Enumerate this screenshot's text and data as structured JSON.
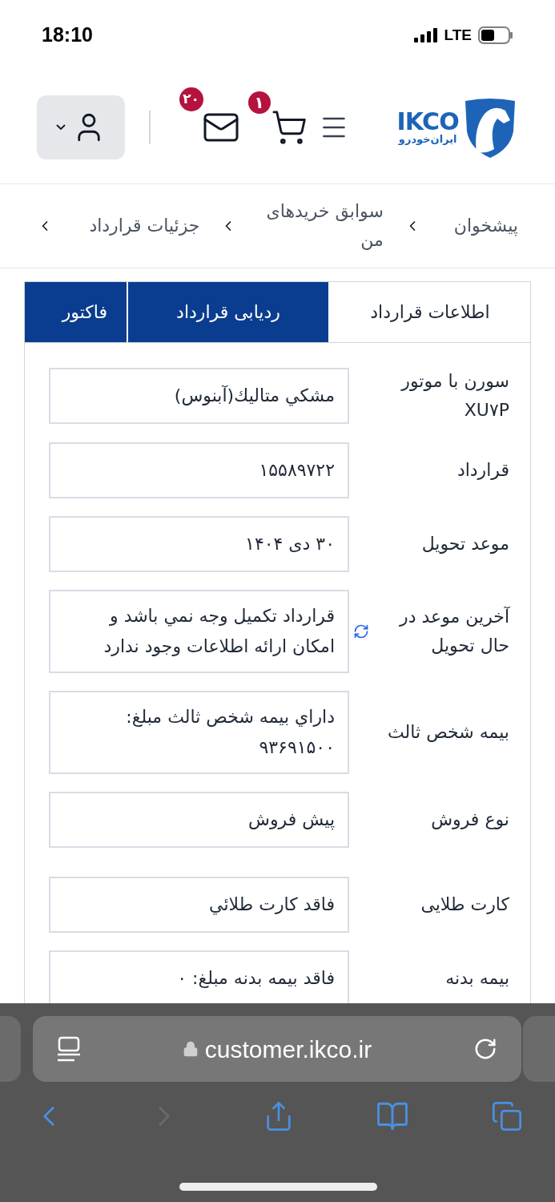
{
  "status_bar": {
    "time": "18:10",
    "network": "LTE"
  },
  "header": {
    "logo_latin": "IKCO",
    "logo_persian": "ایران‌خودرو",
    "cart_count": "۱",
    "mail_count": "۲۰"
  },
  "breadcrumb": [
    {
      "label": "پیشخوان"
    },
    {
      "label": "سوابق خریدهای من"
    },
    {
      "label": "جزئیات قرارداد"
    }
  ],
  "tabs": [
    {
      "label": "اطلاعات قرارداد",
      "selected": true
    },
    {
      "label": "ردیابی قرارداد",
      "selected": false
    },
    {
      "label": "فاکتور",
      "selected": false
    }
  ],
  "fields": [
    {
      "kind": "plain",
      "label": "سورن با موتور XU۷P",
      "value": "مشكي متاليك(آبنوس)"
    },
    {
      "kind": "plain",
      "label": "قرارداد",
      "value": "۱۵۵۸۹۷۲۲"
    },
    {
      "kind": "plain",
      "label": "موعد تحویل",
      "value": "۳۰ دی ۱۴۰۴"
    },
    {
      "kind": "refresh",
      "label": "آخرین موعد در حال تحویل",
      "value": "قرارداد تكميل وجه نمي باشد و امکان ارائه اطلاعات وجود ندارد"
    },
    {
      "kind": "plain",
      "label": "بیمه شخص ثالث",
      "value": "داراي بيمه شخص ثالث مبلغ: ۹۳۶۹۱۵۰۰"
    },
    {
      "kind": "plain",
      "label": "نوع فروش",
      "value": "پیش فروش"
    },
    {
      "kind": "spaced",
      "label": "کارت طلایی",
      "value": "فاقد کارت طلائي"
    },
    {
      "kind": "plain",
      "label": "بیمه بدنه",
      "value": "فاقد بیمه بدنه مبلغ: ۰"
    }
  ],
  "browser": {
    "url": "customer.ikco.ir"
  }
}
